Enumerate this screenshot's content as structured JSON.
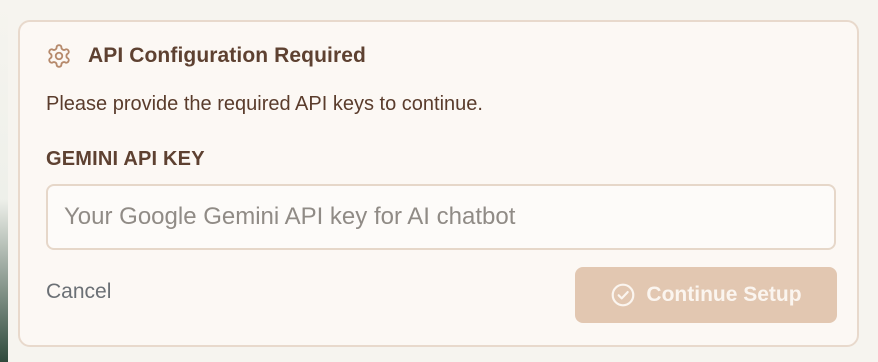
{
  "dialog": {
    "icon": "gear-icon",
    "title": "API Configuration Required",
    "description": "Please provide the required API keys to continue.",
    "field_label": "GEMINI API KEY",
    "input": {
      "value": "",
      "placeholder": "Your Google Gemini API key for AI chatbot"
    },
    "cancel_label": "Cancel",
    "continue_label": "Continue Setup",
    "continue_icon": "check-circle-icon",
    "continue_enabled": false
  },
  "colors": {
    "accent": "#e2c7b1",
    "title_text": "#5e4131",
    "card_background": "#fcf8f4",
    "card_border": "#e8d9cc",
    "muted_text": "#6b7075"
  }
}
